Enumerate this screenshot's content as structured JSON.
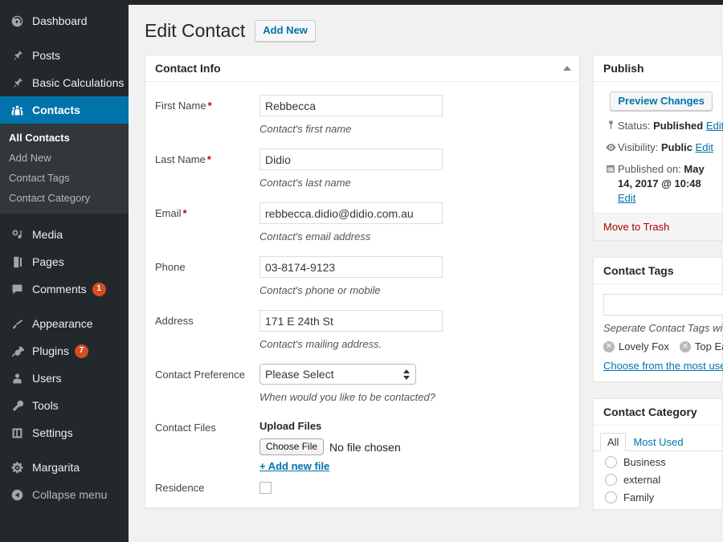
{
  "sidebar": {
    "items": [
      {
        "label": "Dashboard",
        "icon": "dashboard-icon",
        "name": "dashboard"
      },
      {
        "label": "Posts",
        "icon": "pin-icon",
        "name": "posts"
      },
      {
        "label": "Basic Calculations",
        "icon": "pin-icon",
        "name": "basic-calculations"
      },
      {
        "label": "Contacts",
        "icon": "contacts-icon",
        "name": "contacts",
        "current": true
      },
      {
        "label": "Media",
        "icon": "media-icon",
        "name": "media"
      },
      {
        "label": "Pages",
        "icon": "pages-icon",
        "name": "pages"
      },
      {
        "label": "Comments",
        "icon": "comments-icon",
        "name": "comments",
        "badge": "1"
      },
      {
        "label": "Appearance",
        "icon": "brush-icon",
        "name": "appearance"
      },
      {
        "label": "Plugins",
        "icon": "plug-icon",
        "name": "plugins",
        "badge": "7"
      },
      {
        "label": "Users",
        "icon": "user-icon",
        "name": "users"
      },
      {
        "label": "Tools",
        "icon": "wrench-icon",
        "name": "tools"
      },
      {
        "label": "Settings",
        "icon": "settings-icon",
        "name": "settings"
      },
      {
        "label": "Margarita",
        "icon": "gear-icon",
        "name": "margarita"
      },
      {
        "label": "Collapse menu",
        "icon": "collapse-icon",
        "name": "collapse-menu"
      }
    ],
    "submenu": [
      {
        "label": "All Contacts",
        "active": true
      },
      {
        "label": "Add New",
        "active": false
      },
      {
        "label": "Contact Tags",
        "active": false
      },
      {
        "label": "Contact Category",
        "active": false
      }
    ],
    "accent_color": "#0073aa",
    "badge_color": "#d54e21"
  },
  "header": {
    "title": "Edit Contact",
    "add_new_label": "Add New"
  },
  "contact_info": {
    "panel_title": "Contact Info",
    "fields": [
      {
        "label": "First Name",
        "required": true,
        "value": "Rebbecca",
        "desc": "Contact's first name"
      },
      {
        "label": "Last Name",
        "required": true,
        "value": "Didio",
        "desc": "Contact's last name"
      },
      {
        "label": "Email",
        "required": true,
        "value": "rebbecca.didio@didio.com.au",
        "desc": "Contact's email address"
      },
      {
        "label": "Phone",
        "required": false,
        "value": "03-8174-9123",
        "desc": "Contact's phone or mobile"
      },
      {
        "label": "Address",
        "required": false,
        "value": "171 E 24th St",
        "desc": "Contact's mailing address."
      }
    ],
    "preference": {
      "label": "Contact Preference",
      "selected": "Please Select",
      "options": [
        "Please Select"
      ],
      "desc": "When would you like to be contacted?"
    },
    "files": {
      "label": "Contact Files",
      "upload_title": "Upload Files",
      "choose_file_label": "Choose File",
      "no_file_text": "No file chosen",
      "add_new_file_label": "+ Add new file"
    },
    "residence": {
      "label": "Residence",
      "checked": false
    }
  },
  "publish": {
    "title": "Publish",
    "preview_label": "Preview Changes",
    "status_label": "Status:",
    "status_value": "Published",
    "status_edit": "Edit",
    "visibility_label": "Visibility:",
    "visibility_value": "Public",
    "visibility_edit": "Edit",
    "published_label": "Published on:",
    "published_value": "May 14, 2017 @ 10:48",
    "published_edit": "Edit",
    "trash_label": "Move to Trash",
    "trash_color": "#a00"
  },
  "contact_tags": {
    "title": "Contact Tags",
    "input_value": "",
    "desc": "Seperate Contact Tags with commas",
    "tags": [
      "Lovely Fox",
      "Top East"
    ],
    "choose_link": "Choose from the most used Contact Tags"
  },
  "contact_category": {
    "title": "Contact Category",
    "tabs": [
      {
        "label": "All",
        "active": true
      },
      {
        "label": "Most Used",
        "active": false
      }
    ],
    "items": [
      {
        "label": "Business",
        "checked": false
      },
      {
        "label": "external",
        "checked": false
      },
      {
        "label": "Family",
        "checked": false
      }
    ]
  }
}
